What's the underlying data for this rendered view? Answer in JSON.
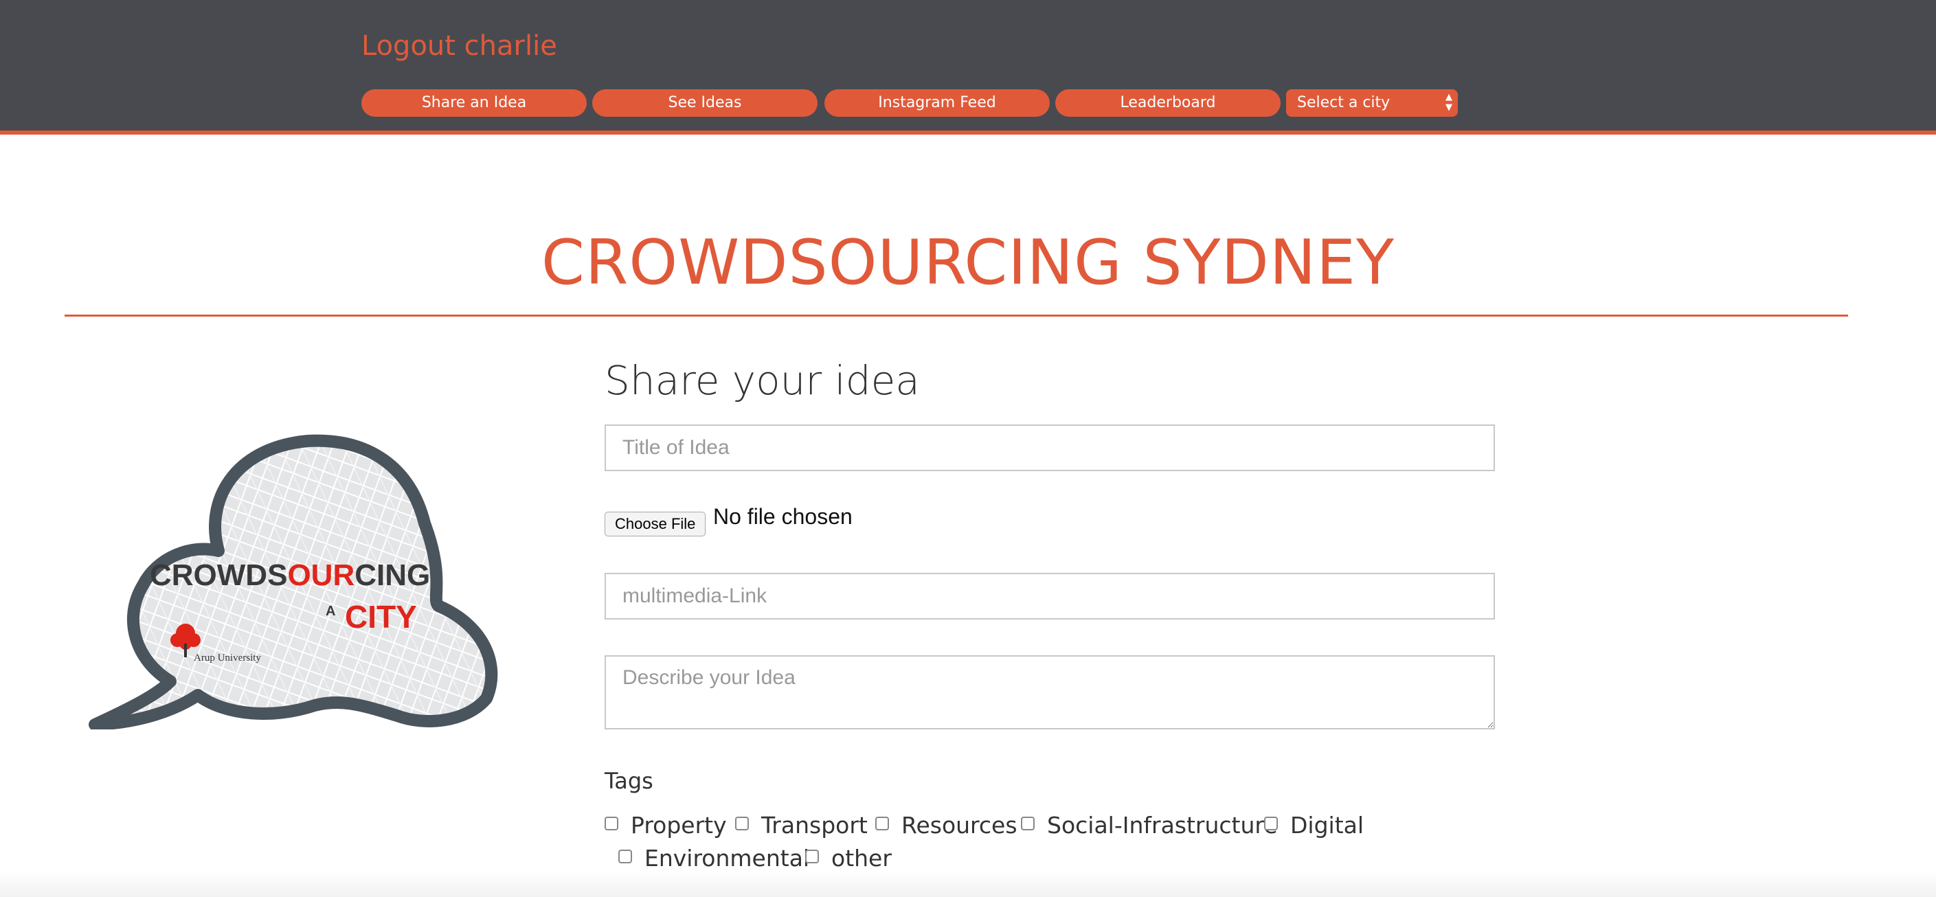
{
  "header": {
    "logout_label": "Logout charlie",
    "nav": [
      {
        "label": "Share an Idea"
      },
      {
        "label": "See Ideas"
      },
      {
        "label": "Instagram Feed"
      },
      {
        "label": "Leaderboard"
      }
    ],
    "city_select": {
      "selected": "Select a city",
      "icon": "updown-arrows-icon"
    }
  },
  "page": {
    "title": "CROWDSOURCING SYDNEY"
  },
  "logo": {
    "line1_a": "CROWDS",
    "line1_b": "OUR",
    "line1_c": "CING",
    "line2_a": "A",
    "line2_b": "CITY",
    "org": "Arup University"
  },
  "form": {
    "heading": "Share your idea",
    "title_placeholder": "Title of Idea",
    "file_button": "Choose File",
    "file_status": "No file chosen",
    "link_placeholder": "multimedia-Link",
    "description_placeholder": "Describe your Idea",
    "tags_label": "Tags",
    "tags": [
      {
        "label": "Property"
      },
      {
        "label": "Transport"
      },
      {
        "label": "Resources"
      },
      {
        "label": "Social-Infrastructure"
      },
      {
        "label": "Digital"
      },
      {
        "label": "Environmental"
      },
      {
        "label": "other"
      }
    ]
  },
  "colors": {
    "accent": "#e05a3a",
    "header_bg": "#484a50",
    "logo_outline": "#4a545c",
    "logo_fill": "#e4e5e7"
  }
}
